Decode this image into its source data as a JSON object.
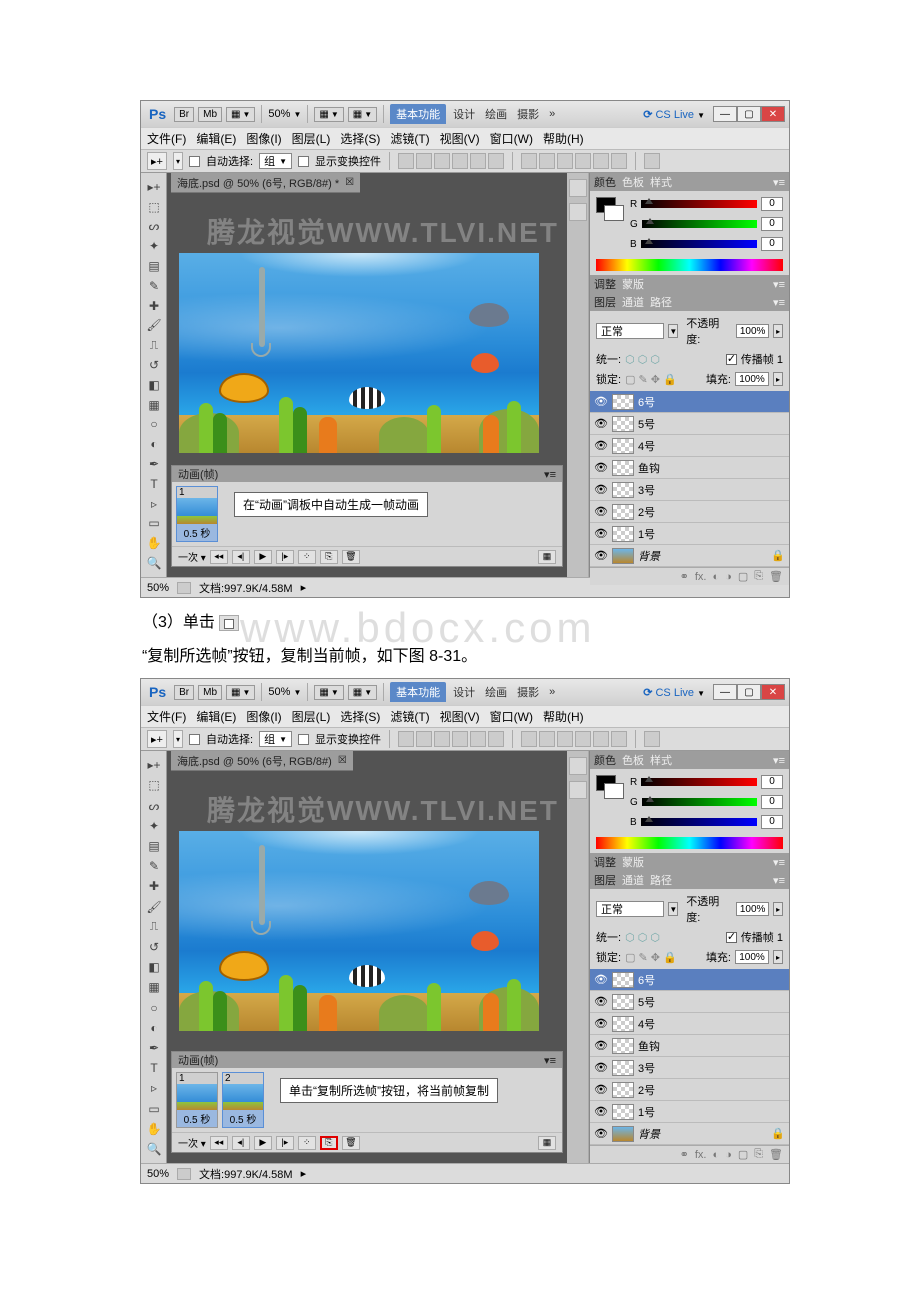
{
  "watermark_canvas": "腾龙视觉WWW.TLVI.NET",
  "watermark_page": "www.bdocx.com",
  "topbar": {
    "ps": "Ps",
    "br": "Br",
    "mb": "Mb",
    "zoom": "50%",
    "workspace_active": "基本功能",
    "workspace_links": [
      "设计",
      "绘画",
      "摄影"
    ],
    "more": "»",
    "cslive": "CS Live"
  },
  "menu": [
    "文件(F)",
    "编辑(E)",
    "图像(I)",
    "图层(L)",
    "选择(S)",
    "滤镜(T)",
    "视图(V)",
    "窗口(W)",
    "帮助(H)"
  ],
  "options": {
    "auto_select_label": "自动选择:",
    "auto_select_value": "组",
    "show_transform": "显示变换控件"
  },
  "doc_tab_1": "海底.psd @ 50% (6号, RGB/8#) *",
  "doc_tab_2": "海底.psd @ 50% (6号, RGB/8#)",
  "anim_panel_title": "动画(帧)",
  "frame_time": "0.5 秒",
  "loop": "一次",
  "annotation1": "在“动画”调板中自动生成一帧动画",
  "annotation2": "单击“复制所选帧”按钮，将当前帧复制",
  "status_zoom": "50%",
  "status_doc": "文档:997.9K/4.58M",
  "right": {
    "tabs_color": [
      "颜色",
      "色板",
      "样式"
    ],
    "tabs_adjust": [
      "调整",
      "蒙版"
    ],
    "tabs_layers": [
      "图层",
      "通道",
      "路径"
    ],
    "rgb_r": "R",
    "rgb_g": "G",
    "rgb_b": "B",
    "rgb_val": "0",
    "blend_mode": "正常",
    "opacity_label": "不透明度:",
    "opacity_val": "100%",
    "unify_label": "统一:",
    "propagate": "传播帧 1",
    "lock_label": "锁定:",
    "fill_label": "填充:",
    "fill_val": "100%",
    "layers": [
      "6号",
      "5号",
      "4号",
      "鱼钩",
      "3号",
      "2号",
      "1号",
      "背景"
    ]
  },
  "body_text": {
    "line1a": "（3）单击",
    "line1b": "",
    "line2": "“复制所选帧”按钮，复制当前帧，如下图 8-31。"
  }
}
